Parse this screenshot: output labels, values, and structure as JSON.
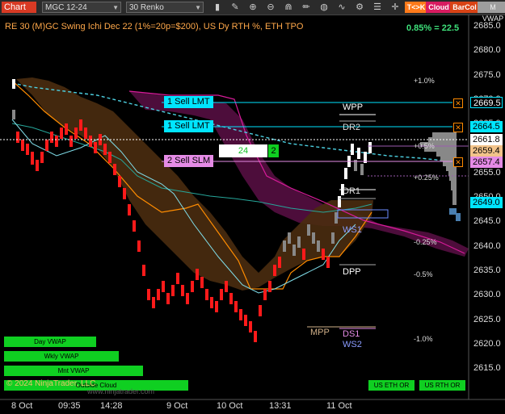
{
  "toolbar": {
    "chart_label": "Chart",
    "instrument": "MGC 12-24",
    "bar_type": "30 Renko",
    "icons": [
      "bar-style-icon",
      "ruler-icon",
      "zoom-in-icon",
      "zoom-out-icon",
      "magnet-icon",
      "pencil-icon",
      "globe-icon",
      "indicator-icon",
      "strategy-icon",
      "properties-icon"
    ],
    "tk_label": "T<>K",
    "cloud_label": "Cloud",
    "barcol_label": "BarCol",
    "mvwap_label": "M VWAP",
    "colors": {
      "tk": "#ff7a1a",
      "cloud": "#d81b60",
      "barcol": "#d84315"
    }
  },
  "chart": {
    "title": "RE 30 (M)GC Swing Ichi Dec 22 (1%=20p=$200), US Dy RTH %, ETH TPO",
    "pct_readout": "0.85% = 22.5",
    "copyright": "© 2024 NinjaTrader, LLC",
    "watermark": "www.ninjatrader.com",
    "y_ticks": [
      "2685.0",
      "2680.0",
      "2675.0",
      "2670.0",
      "2665.0",
      "2660.0",
      "2655.0",
      "2650.0",
      "2645.0",
      "2640.0",
      "2635.0",
      "2630.0",
      "2625.0",
      "2620.0",
      "2615.0"
    ],
    "x_ticks": [
      "8 Oct",
      "09:35",
      "14:28",
      "9 Oct",
      "10 Oct",
      "13:31",
      "11 Oct"
    ],
    "price_tags": [
      {
        "text": "2669.5",
        "bg": "#000",
        "fg": "#fff",
        "border": "#00e5ff"
      },
      {
        "text": "2664.5",
        "bg": "#00e5ff",
        "fg": "#000",
        "border": "#00e5ff"
      },
      {
        "text": "2661.8",
        "bg": "#fff",
        "fg": "#000",
        "border": "#fff"
      },
      {
        "text": "2659.4",
        "bg": "#f2c38a",
        "fg": "#000",
        "border": "#f2c38a"
      },
      {
        "text": "2657.4",
        "bg": "#e58be6",
        "fg": "#000",
        "border": "#e58be6"
      },
      {
        "text": "2649.0",
        "bg": "#00e5ff",
        "fg": "#000",
        "border": "#00e5ff"
      }
    ],
    "orders": [
      {
        "label": "1 Sell LMT",
        "color": "#00e5ff"
      },
      {
        "label": "1 Sell LMT",
        "color": "#00e5ff"
      },
      {
        "label": "2 Sell SLM",
        "color": "#e58be6"
      }
    ],
    "quantity": "24",
    "position_qty": "2",
    "levels": {
      "wpp": "WPP",
      "dr2": "DR2",
      "dr1": "DR1",
      "ws1": "WS1",
      "dpp": "DPP",
      "mpp": "MPP",
      "ds1": "DS1",
      "ws2": "WS2"
    },
    "percent_levels": [
      "+1.0%",
      "+0.5%",
      "+0.25%",
      "-0.25%",
      "-0.5%",
      "-1.0%"
    ],
    "buttons": {
      "day_vwap": "Day VWAP",
      "wkly_vwap": "Wkly VWAP",
      "mnt_vwap": "Mnt VWAP",
      "outside_cloud": "Outside Cloud",
      "us_eth_or": "US ETH OR",
      "us_rth_or": "US RTH OR"
    }
  }
}
